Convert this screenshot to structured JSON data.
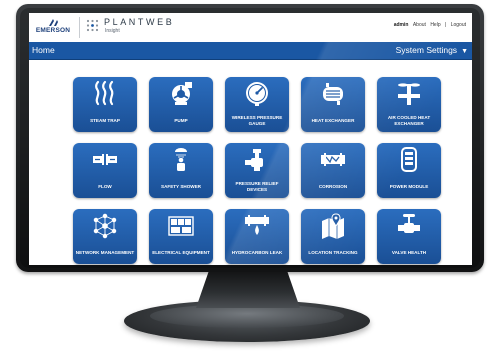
{
  "header": {
    "emerson_logo_text": "EMERSON",
    "product_name": "PLANTWEB",
    "product_sub": "Insight",
    "links": {
      "user": "admin",
      "about": "About",
      "sep1": "|",
      "help": "Help",
      "sep2": "|",
      "logout": "Logout"
    }
  },
  "navbar": {
    "home": "Home",
    "settings": "System Settings",
    "caret": "▼"
  },
  "tiles": [
    {
      "label": "STEAM TRAP",
      "icon": "steam-icon"
    },
    {
      "label": "PUMP",
      "icon": "pump-icon"
    },
    {
      "label": "WIRELESS PRESSURE GAUGE",
      "icon": "gauge-icon"
    },
    {
      "label": "HEAT EXCHANGER",
      "icon": "heat-exchanger-icon"
    },
    {
      "label": "AIR COOLED HEAT EXCHANGER",
      "icon": "air-cooled-exchanger-icon"
    },
    {
      "label": "FLOW",
      "icon": "flow-icon"
    },
    {
      "label": "SAFETY SHOWER",
      "icon": "safety-shower-icon"
    },
    {
      "label": "PRESSURE RELIEF DEVICES",
      "icon": "pressure-relief-icon"
    },
    {
      "label": "CORROSION",
      "icon": "corrosion-icon"
    },
    {
      "label": "POWER MODULE",
      "icon": "power-module-icon"
    },
    {
      "label": "NETWORK MANAGEMENT",
      "icon": "network-icon"
    },
    {
      "label": "ELECTRICAL EQUIPMENT",
      "icon": "electrical-equipment-icon"
    },
    {
      "label": "HYDROCARBON LEAK",
      "icon": "hydrocarbon-leak-icon"
    },
    {
      "label": "LOCATION TRACKING",
      "icon": "location-tracking-icon"
    },
    {
      "label": "VALVE HEALTH",
      "icon": "valve-icon"
    }
  ],
  "colors": {
    "nav_bar": "#1a57a3",
    "tile": "#1f5aa6",
    "brand": "#1c3f7a"
  }
}
